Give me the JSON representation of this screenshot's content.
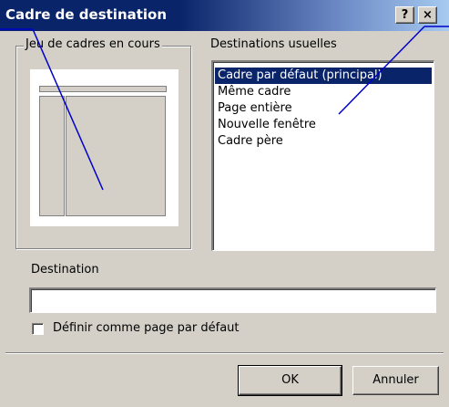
{
  "window": {
    "title": "Cadre de destination",
    "help_button": "?",
    "close_button": "×"
  },
  "frameset_group": {
    "legend": "Jeu de cadres en cours"
  },
  "destinations": {
    "label": "Destinations usuelles",
    "items": [
      {
        "label": "Cadre par défaut (principal)",
        "selected": true
      },
      {
        "label": "Même cadre",
        "selected": false
      },
      {
        "label": "Page entière",
        "selected": false
      },
      {
        "label": "Nouvelle fenêtre",
        "selected": false
      },
      {
        "label": "Cadre père",
        "selected": false
      }
    ]
  },
  "destination_field": {
    "label": "Destination",
    "value": ""
  },
  "default_checkbox": {
    "label": "Définir comme page par défaut",
    "checked": false
  },
  "buttons": {
    "ok": "OK",
    "cancel": "Annuler"
  },
  "colors": {
    "title_bar": "#0a246a",
    "selection": "#0a246a",
    "face": "#d4d0c8",
    "annotation_line": "#0000cc"
  }
}
